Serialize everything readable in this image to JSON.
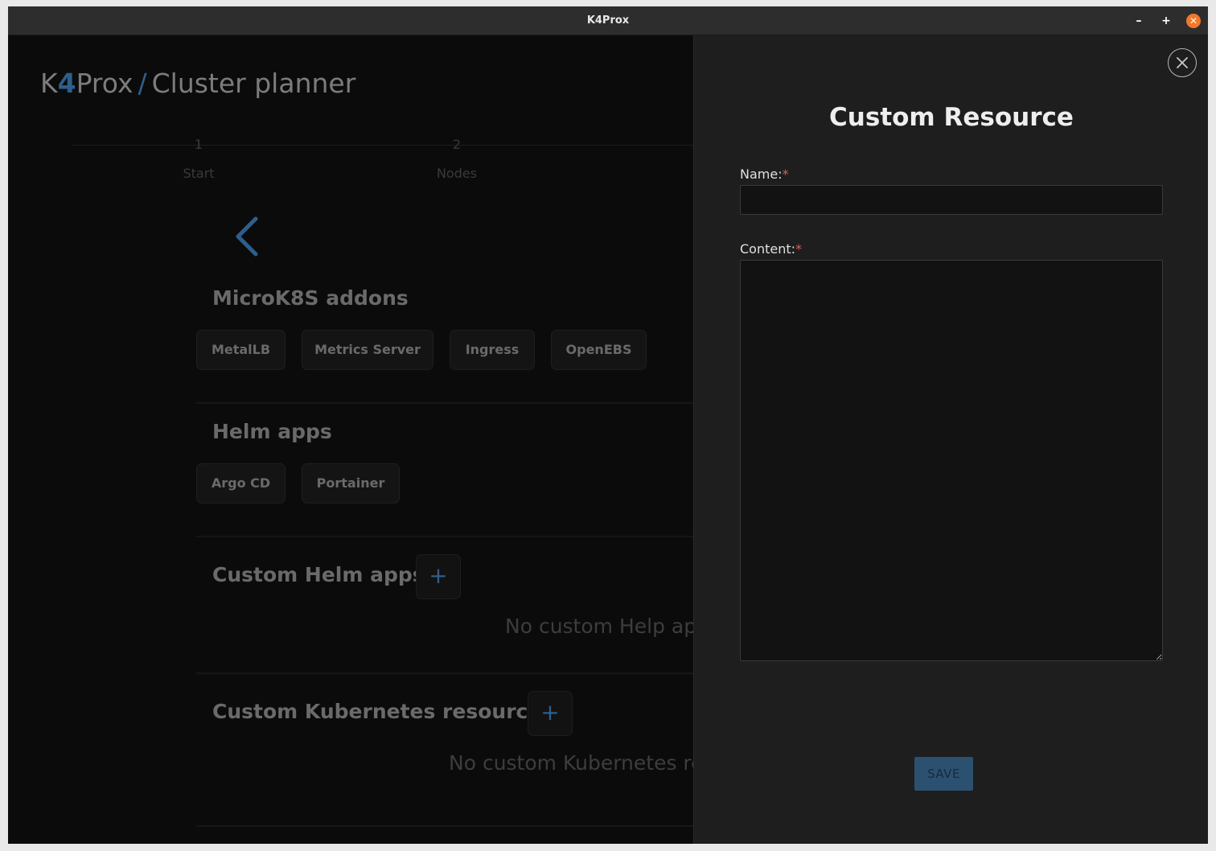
{
  "window": {
    "title": "K4Prox"
  },
  "brand": {
    "k": "K",
    "four": "4",
    "prox": "Prox",
    "slash": "/",
    "page": "Cluster planner"
  },
  "stepper": [
    {
      "number": "1",
      "label": "Start"
    },
    {
      "number": "2",
      "label": "Nodes"
    }
  ],
  "sections": {
    "addons": {
      "title": "MicroK8S addons",
      "chips": [
        "MetalLB",
        "Metrics Server",
        "Ingress",
        "OpenEBS"
      ]
    },
    "helm": {
      "title": "Helm apps",
      "chips": [
        "Argo CD",
        "Portainer"
      ]
    },
    "custom_helm": {
      "title": "Custom Helm apps",
      "empty": "No custom Help app"
    },
    "custom_k8s": {
      "title": "Custom Kubernetes resources",
      "empty": "No custom Kubernetes re"
    }
  },
  "panel": {
    "title": "Custom Resource",
    "name_label": "Name:",
    "content_label": "Content:",
    "required_mark": "*",
    "name_value": "",
    "content_value": "",
    "save_label": "SAVE"
  },
  "colors": {
    "accent": "#2e5f8c",
    "panel_bg": "#1e1e1e",
    "required": "#e0595c",
    "close_button": "#f0782a"
  }
}
